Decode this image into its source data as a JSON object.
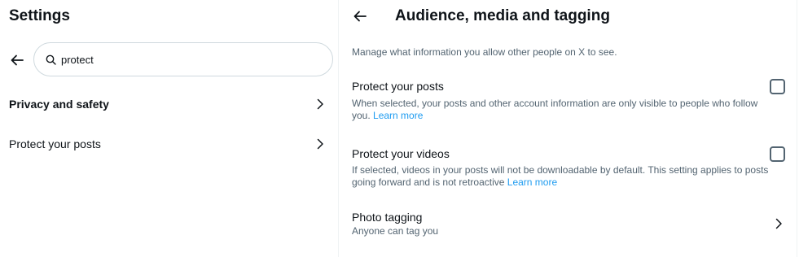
{
  "left": {
    "title": "Settings",
    "search": {
      "value": "protect"
    },
    "results": [
      {
        "label": "Privacy and safety",
        "bold": true
      },
      {
        "label": "Protect your posts",
        "bold": false
      }
    ]
  },
  "right": {
    "title": "Audience, media and tagging",
    "description": "Manage what information you allow other people on X to see.",
    "options": [
      {
        "title": "Protect your posts",
        "description": "When selected, your posts and other account information are only visible to people who follow you.",
        "link": "Learn more",
        "checked": false
      },
      {
        "title": "Protect your videos",
        "description": "If selected, videos in your posts will not be downloadable by default. This setting applies to posts going forward and is not retroactive",
        "link": "Learn more",
        "checked": false
      }
    ],
    "photo_tagging": {
      "title": "Photo tagging",
      "subtitle": "Anyone can tag you"
    }
  },
  "colors": {
    "text_primary": "#0f1419",
    "text_secondary": "#536471",
    "link": "#1d9bf0",
    "border": "#cfd9de",
    "divider": "#eff3f4"
  },
  "icons": [
    "back-arrow-icon",
    "search-icon",
    "chevron-right-icon"
  ]
}
